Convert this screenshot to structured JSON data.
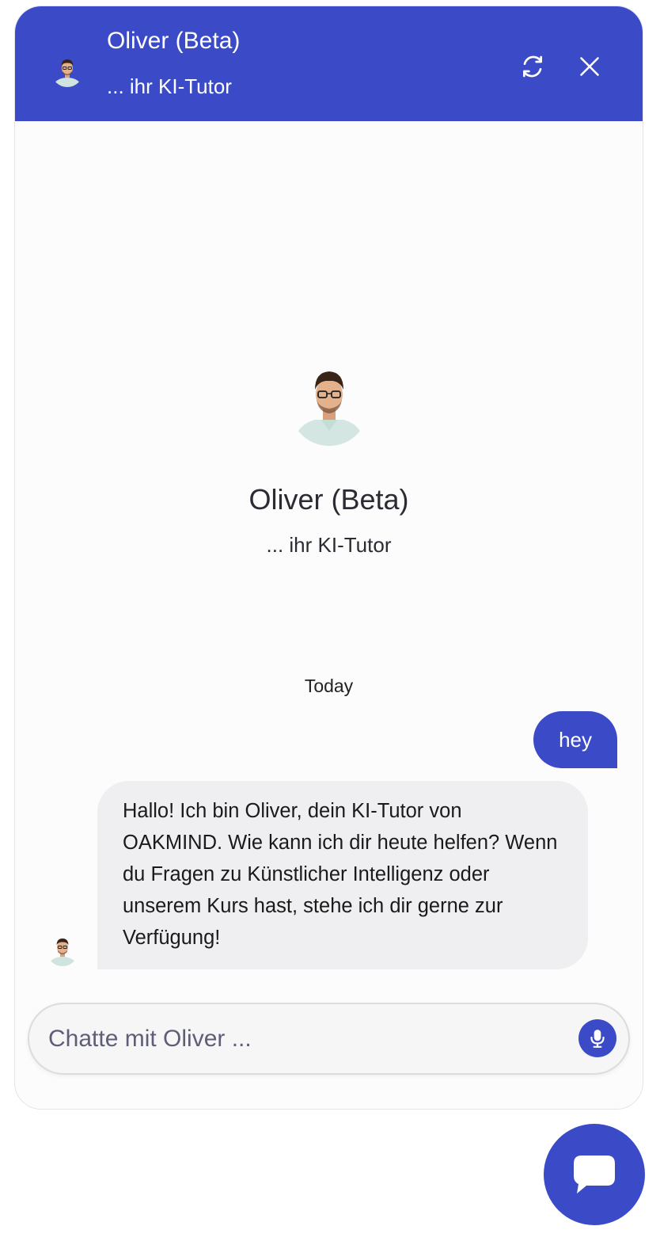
{
  "header": {
    "title": "Oliver (Beta)",
    "subtitle": "... ihr KI-Tutor",
    "avatar_icon": "person-avatar-icon",
    "refresh_icon": "refresh-icon",
    "close_icon": "close-icon"
  },
  "intro": {
    "name": "Oliver (Beta)",
    "subtitle": "... ihr KI-Tutor"
  },
  "conversation": {
    "date_label": "Today",
    "messages": [
      {
        "sender": "user",
        "text": "hey"
      },
      {
        "sender": "bot",
        "text": "Hallo! Ich bin Oliver, dein KI-Tutor von OAKMIND. Wie kann ich dir heute helfen? Wenn du Fragen zu Künstlicher Intelligenz oder unserem Kurs hast, stehe ich dir gerne zur Verfügung!"
      }
    ]
  },
  "composer": {
    "placeholder": "Chatte mit Oliver ...",
    "value": "",
    "mic_icon": "microphone-icon"
  },
  "launcher": {
    "icon": "chat-bubble-icon"
  },
  "colors": {
    "accent": "#3b4bc8",
    "bot_bubble": "#efeff1",
    "background": "#fcfcfc"
  }
}
